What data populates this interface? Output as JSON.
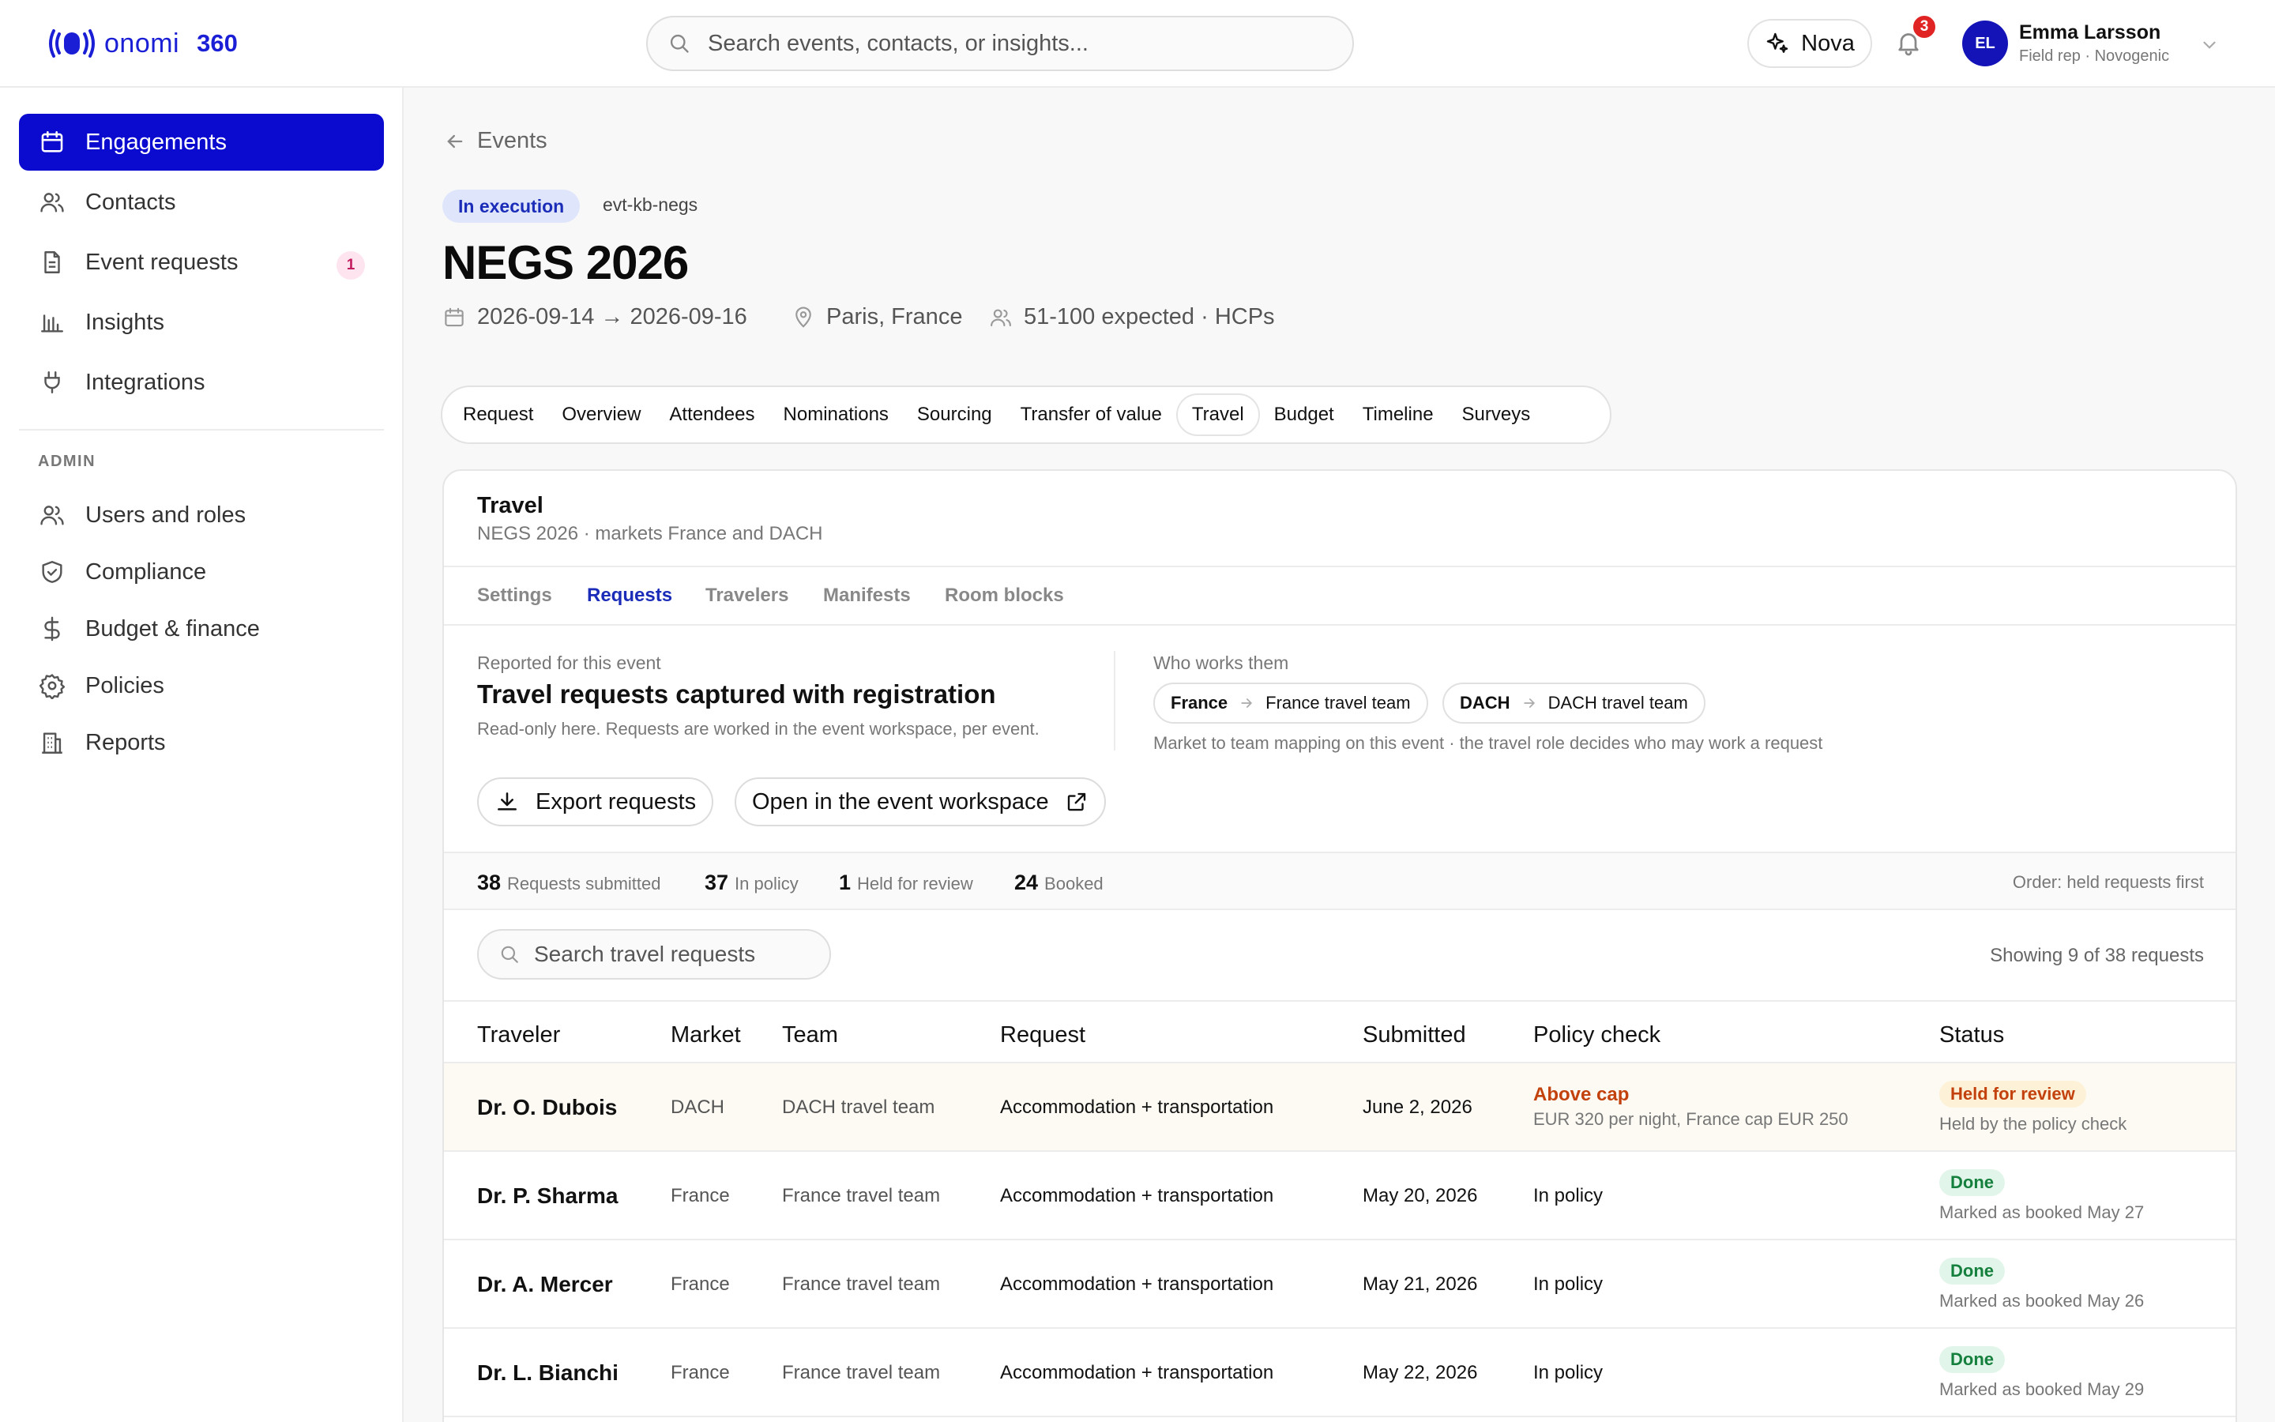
{
  "app": {
    "logo_word": "onomi",
    "logo_suffix": "360"
  },
  "topbar": {
    "search_placeholder": "Search events, contacts, or insights...",
    "assistant_label": "Nova",
    "notification_count": "3",
    "user": {
      "initials": "EL",
      "name": "Emma Larsson",
      "role": "Field rep · Novogenic"
    }
  },
  "sidebar": {
    "items": [
      {
        "label": "Engagements",
        "icon": "calendar-icon",
        "active": true
      },
      {
        "label": "Contacts",
        "icon": "users-icon"
      },
      {
        "label": "Event requests",
        "icon": "document-icon",
        "badge": "1"
      },
      {
        "label": "Insights",
        "icon": "bar-chart-icon"
      },
      {
        "label": "Integrations",
        "icon": "plug-icon"
      }
    ],
    "admin_label": "ADMIN",
    "admin_items": [
      {
        "label": "Users and roles",
        "icon": "users-icon"
      },
      {
        "label": "Compliance",
        "icon": "shield-icon"
      },
      {
        "label": "Budget & finance",
        "icon": "dollar-icon"
      },
      {
        "label": "Policies",
        "icon": "gear-icon"
      },
      {
        "label": "Reports",
        "icon": "building-icon"
      }
    ]
  },
  "event": {
    "back_label": "Events",
    "status": "In execution",
    "id": "evt-kb-negs",
    "title": "NEGS 2026",
    "dates": "2026-09-14 → 2026-09-16",
    "location": "Paris, France",
    "audience": "51-100 expected · HCPs"
  },
  "tabs": [
    "Request",
    "Overview",
    "Attendees",
    "Nominations",
    "Sourcing",
    "Transfer of value",
    "Travel",
    "Budget",
    "Timeline",
    "Surveys"
  ],
  "active_tab": "Travel",
  "travel": {
    "title": "Travel",
    "subtitle": "NEGS 2026 · markets France and DACH",
    "subtabs": [
      "Settings",
      "Requests",
      "Travelers",
      "Manifests",
      "Room blocks"
    ],
    "active_subtab": "Requests",
    "reported_label": "Reported for this event",
    "reported_title": "Travel requests captured with registration",
    "reported_note": "Read-only here. Requests are worked in the event workspace, per event.",
    "who_label": "Who works them",
    "mappings": [
      {
        "market": "France",
        "team": "France travel team"
      },
      {
        "market": "DACH",
        "team": "DACH travel team"
      }
    ],
    "mapping_note": "Market to team mapping on this event · the travel role decides who may work a request",
    "export_label": "Export requests",
    "open_label": "Open in the event workspace",
    "stats": [
      {
        "value": "38",
        "label": "Requests submitted"
      },
      {
        "value": "37",
        "label": "In policy"
      },
      {
        "value": "1",
        "label": "Held for review"
      },
      {
        "value": "24",
        "label": "Booked"
      }
    ],
    "order_note": "Order: held requests first",
    "search_placeholder": "Search travel requests",
    "showing": "Showing 9 of 38 requests",
    "columns": [
      "Traveler",
      "Market",
      "Team",
      "Request",
      "Submitted",
      "Policy check",
      "Status"
    ],
    "rows": [
      {
        "traveler": "Dr. O. Dubois",
        "market": "DACH",
        "team": "DACH travel team",
        "request": "Accommodation + transportation",
        "submitted": "June 2, 2026",
        "policy": "Above cap",
        "policy_detail": "EUR 320 per night, France cap EUR 250",
        "status": "Held for review",
        "status_note": "Held by the policy check",
        "held": true
      },
      {
        "traveler": "Dr. P. Sharma",
        "market": "France",
        "team": "France travel team",
        "request": "Accommodation + transportation",
        "submitted": "May 20, 2026",
        "policy": "In policy",
        "status": "Done",
        "status_note": "Marked as booked May 27"
      },
      {
        "traveler": "Dr. A. Mercer",
        "market": "France",
        "team": "France travel team",
        "request": "Accommodation + transportation",
        "submitted": "May 21, 2026",
        "policy": "In policy",
        "status": "Done",
        "status_note": "Marked as booked May 26"
      },
      {
        "traveler": "Dr. L. Bianchi",
        "market": "France",
        "team": "France travel team",
        "request": "Accommodation + transportation",
        "submitted": "May 22, 2026",
        "policy": "In policy",
        "status": "Done",
        "status_note": "Marked as booked May 29"
      }
    ]
  },
  "colors": {
    "brand": "#1a1fd6",
    "active_nav": "#0b0bd0",
    "warn": "#c2410c",
    "success": "#15803d",
    "badge_red": "#e02424"
  }
}
